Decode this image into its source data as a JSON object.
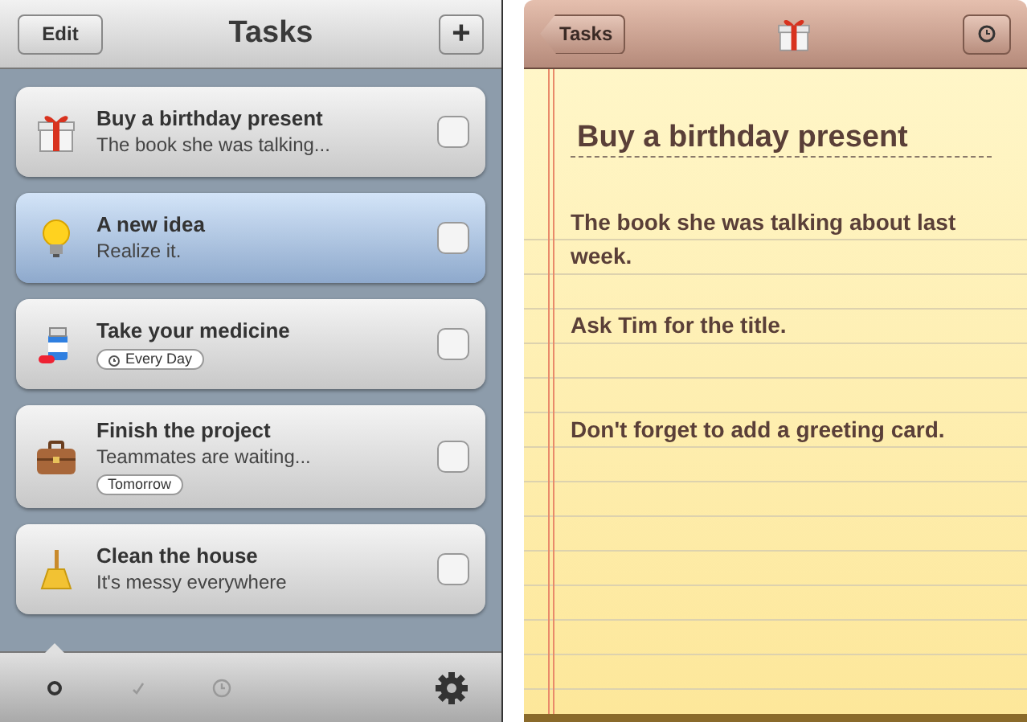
{
  "tasks_screen": {
    "edit_button": "Edit",
    "title": "Tasks",
    "add_button": "+",
    "tasks": [
      {
        "kind": "gift",
        "title": "Buy a birthday present",
        "note": "The book she was talking...",
        "checked": false,
        "selected": false
      },
      {
        "kind": "bulb",
        "title": "A new idea",
        "note": "Realize it.",
        "checked": false,
        "selected": true
      },
      {
        "kind": "medicine",
        "title": "Take your medicine",
        "tag": {
          "text": "Every Day",
          "alarm": true
        },
        "checked": false,
        "selected": false
      },
      {
        "kind": "briefcase",
        "title": "Finish the project",
        "note": "Teammates are waiting...",
        "tag": {
          "text": "Tomorrow",
          "alarm": false
        },
        "checked": false,
        "selected": false
      },
      {
        "kind": "broom",
        "title": "Clean the house",
        "note": "It's messy everywhere",
        "checked": false,
        "selected": false
      }
    ],
    "tabs": [
      {
        "kind": "open",
        "selected": true
      },
      {
        "kind": "done",
        "selected": false
      },
      {
        "kind": "scheduled",
        "selected": false
      }
    ]
  },
  "note_screen": {
    "back_button": "Tasks",
    "kind": "gift",
    "title": "Buy a birthday present",
    "paragraphs": [
      "The book she was talking about last week.",
      "Ask Tim for the title.",
      "Don't forget to add a greeting card."
    ]
  }
}
